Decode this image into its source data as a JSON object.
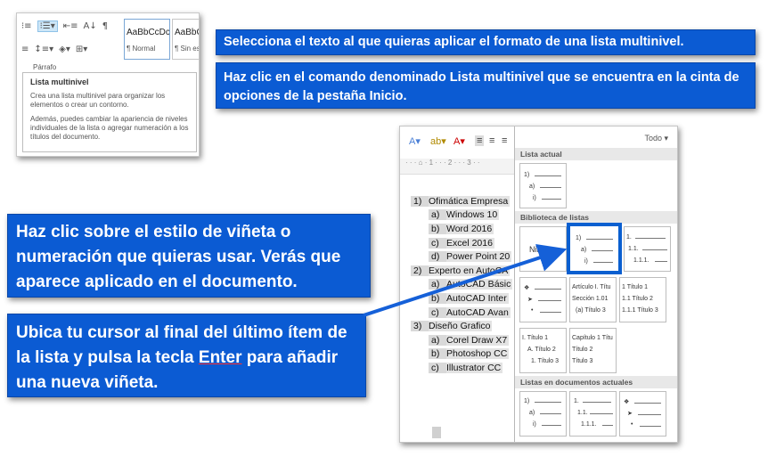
{
  "ribbon": {
    "style_1_preview": "AaBbCcDc",
    "style_1_name": "¶ Normal",
    "style_2_preview": "AaBbCc",
    "style_2_name": "¶ Sin esp",
    "group_label": "Párrafo",
    "tooltip": {
      "title": "Lista multinivel",
      "p1": "Crea una lista multinivel para organizar los elementos o crear un contorno.",
      "p2": "Además, puedes cambiar la apariencia de niveles individuales de la lista o agregar numeración a los títulos del documento."
    }
  },
  "callouts": {
    "c1": "Selecciona el texto al que quieras aplicar el formato de una lista multinivel.",
    "c2": "Haz clic en el comando denominado Lista multinivel que se encuentra en la cinta de opciones de la pestaña Inicio.",
    "c3": "Haz clic sobre el estilo de viñeta o numeración que quieras usar. Verás que aparece aplicado en el documento.",
    "c4_before": "Ubica tu cursor al final del último ítem de la lista y pulsa la tecla ",
    "c4_key": "Enter",
    "c4_after": " para añadir una nueva viñeta."
  },
  "document": {
    "list": [
      {
        "marker": "1)",
        "text": "Ofimática Empresa",
        "level": 1
      },
      {
        "marker": "a)",
        "text": "Windows 10",
        "level": 2
      },
      {
        "marker": "b)",
        "text": "Word 2016",
        "level": 2
      },
      {
        "marker": "c)",
        "text": "Excel 2016",
        "level": 2
      },
      {
        "marker": "d)",
        "text": "Power Point 20",
        "level": 2
      },
      {
        "marker": "2)",
        "text": "Experto en AutoCA",
        "level": 1
      },
      {
        "marker": "a)",
        "text": "AutoCAD Básic",
        "level": 2
      },
      {
        "marker": "b)",
        "text": "AutoCAD Inter",
        "level": 2
      },
      {
        "marker": "c)",
        "text": "AutoCAD Avan",
        "level": 2
      },
      {
        "marker": "3)",
        "text": "Diseño Grafico",
        "level": 1
      },
      {
        "marker": "a)",
        "text": "Corel Draw X7",
        "level": 2
      },
      {
        "marker": "b)",
        "text": "Photoshop CC",
        "level": 2
      },
      {
        "marker": "c)",
        "text": "Illustrator CC",
        "level": 2
      }
    ]
  },
  "gallery": {
    "todo": "Todo ▾",
    "section_current": "Lista actual",
    "section_library": "Biblioteca de listas",
    "section_docs": "Listas en documentos actuales",
    "none_label": "Ninguno",
    "current_thumb": [
      "1)",
      "a)",
      "i)"
    ],
    "lib_2": [
      "1)",
      "a)",
      "i)"
    ],
    "lib_3": [
      "1.",
      "1.1.",
      "1.1.1."
    ],
    "lib_5": [
      "Artículo I. Títu",
      "Sección 1.01",
      "(a) Título 3"
    ],
    "lib_6": [
      "1 Título 1",
      "1.1 Título 2",
      "1.1.1 Título 3"
    ],
    "lib_7": [
      "I. Título 1",
      "A. Título 2",
      "1. Título 3"
    ],
    "lib_8": [
      "Capítulo 1 Títu",
      "Título 2",
      "Título 3"
    ],
    "doc_1": [
      "1)",
      "a)",
      "i)"
    ],
    "doc_2": [
      "1.",
      "1.1.",
      "1.1.1."
    ]
  },
  "colors": {
    "callout_bg": "#0b5bd3",
    "highlight": "#0a5fd0"
  }
}
